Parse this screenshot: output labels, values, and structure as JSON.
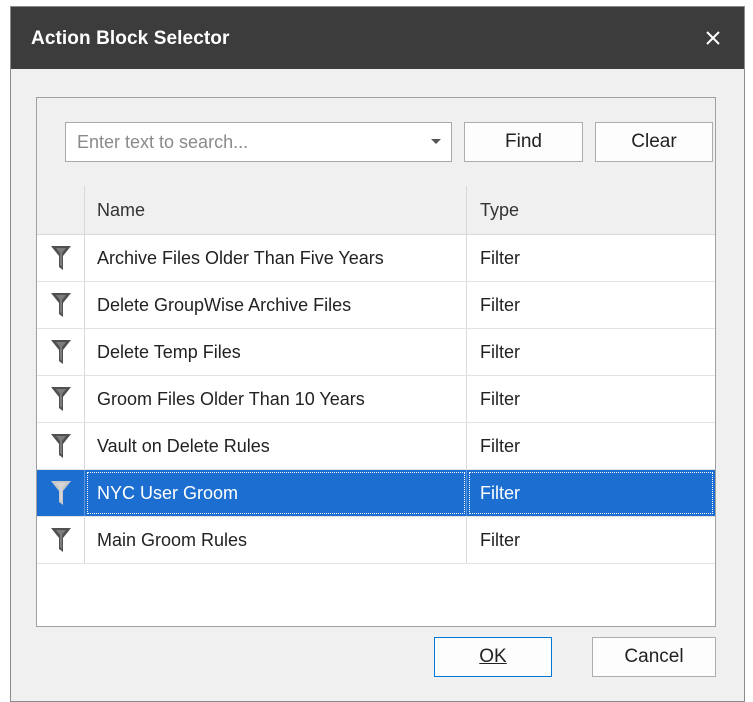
{
  "dialog": {
    "title": "Action Block Selector",
    "close_icon": "close-icon"
  },
  "search": {
    "placeholder": "Enter text to search...",
    "value": "",
    "find_label": "Find",
    "clear_label": "Clear"
  },
  "grid": {
    "columns": [
      "Name",
      "Type"
    ],
    "rows": [
      {
        "icon": "filter-icon",
        "name": "Archive Files Older Than Five Years",
        "type": "Filter"
      },
      {
        "icon": "filter-icon",
        "name": "Delete GroupWise Archive Files",
        "type": "Filter"
      },
      {
        "icon": "filter-icon",
        "name": "Delete Temp Files",
        "type": "Filter"
      },
      {
        "icon": "filter-icon",
        "name": "Groom Files Older Than 10 Years",
        "type": "Filter"
      },
      {
        "icon": "filter-icon",
        "name": "Vault on Delete Rules",
        "type": "Filter"
      },
      {
        "icon": "filter-icon",
        "name": "NYC User Groom",
        "type": "Filter",
        "selected": true
      },
      {
        "icon": "filter-icon",
        "name": "Main Groom Rules",
        "type": "Filter"
      }
    ]
  },
  "footer": {
    "ok_label": "OK",
    "cancel_label": "Cancel"
  },
  "colors": {
    "titlebar": "#3c3c3c",
    "selection": "#1c6fd1",
    "dialog_background": "#f0f0f0"
  }
}
